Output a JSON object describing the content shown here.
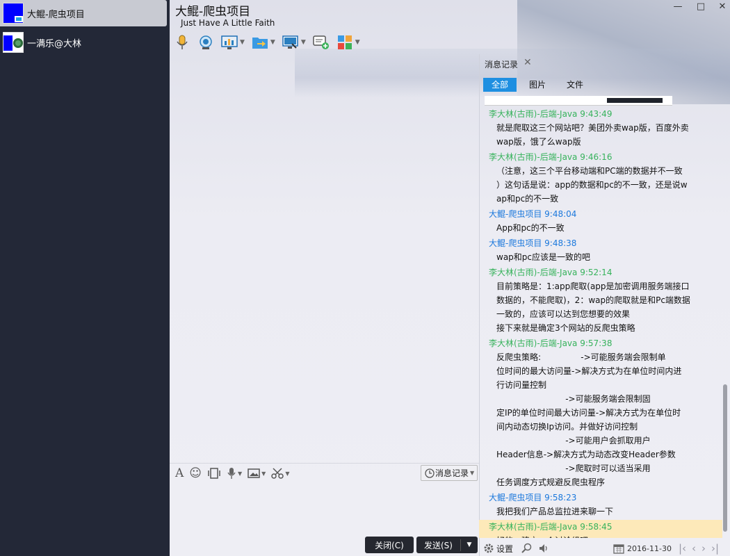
{
  "sessions": [
    {
      "name": "大鲲-爬虫项目",
      "active": true
    },
    {
      "name": "一满乐@大林",
      "active": false
    }
  ],
  "chat": {
    "title": "大鲲-爬虫项目",
    "subtitle": "Just Have A Little Faith"
  },
  "window": {
    "minimize": "—",
    "maximize": "□",
    "close": "✕"
  },
  "toolbar": {
    "icons": [
      "microphone-icon",
      "video-camera-icon",
      "screen-share-icon",
      "file-transfer-icon",
      "remote-desktop-icon",
      "new-discussion-icon",
      "apps-icon"
    ]
  },
  "compose": {
    "font_icon": "A",
    "emoji_icon": "☺",
    "history_label": "消息记录",
    "close_label": "关闭(C)",
    "send_label": "发送(S)"
  },
  "history": {
    "tab_label": "消息记录",
    "filters": [
      "全部",
      "图片",
      "文件"
    ],
    "messages": [
      {
        "sender": "李大林(古雨)-后端-Java",
        "time": "9:43:49",
        "color": "green",
        "text": "就是爬取这三个网站吧？美团外卖wap版，百度外卖\nwap版，饿了么wap版"
      },
      {
        "sender": "李大林(古雨)-后端-Java",
        "time": "9:46:16",
        "color": "green",
        "text": "（注意，这三个平台移动端和PC端的数据并不一致\n）这句话是说：app的数据和pc的不一致，还是说w\nap和pc的不一致"
      },
      {
        "sender": "大鲲-爬虫项目",
        "time": "9:48:04",
        "color": "blue",
        "text": "App和pc的不一致"
      },
      {
        "sender": "大鲲-爬虫项目",
        "time": "9:48:38",
        "color": "blue",
        "text": "wap和pc应该是一致的吧"
      },
      {
        "sender": "李大林(古雨)-后端-Java",
        "time": "9:52:14",
        "color": "green",
        "text": "目前策略是：1:app爬取(app是加密调用服务端接口\n数据的，不能爬取)，2：wap的爬取就是和Pc端数据\n一致的，应该可以达到您想要的效果\n接下来就是确定3个网站的反爬虫策略"
      },
      {
        "sender": "李大林(古雨)-后端-Java",
        "time": "9:57:38",
        "color": "green",
        "text": "反爬虫策略:               ->可能服务端会限制单\n位时间的最大访问量->解决方式为在单位时间内进\n行访问量控制\n                          ->可能服务端会限制固\n定IP的单位时间最大访问量->解决方式为在单位时\n间内动态切换Ip访问。并做好访问控制\n                          ->可能用户会抓取用户\nHeader信息->解决方式为动态改变Header参数\n                          ->爬取时可以适当采用\n任务调度方式规避反爬虫程序"
      },
      {
        "sender": "大鲲-爬虫项目",
        "time": "9:58:23",
        "color": "blue",
        "text": "我把我们产品总监拉进来聊一下"
      },
      {
        "sender": "李大林(古雨)-后端-Java",
        "time": "9:58:45",
        "color": "green",
        "text": "好的，建立一个讨论组吧",
        "highlight": true
      }
    ],
    "footer": {
      "settings_label": "设置",
      "date": "2016-11-30"
    }
  },
  "colors": {
    "sidebar_bg": "#232837",
    "accent": "#1e8fe1",
    "sender_green": "#36b25b",
    "sender_blue": "#1b78dc",
    "highlight": "#fde9b9"
  }
}
